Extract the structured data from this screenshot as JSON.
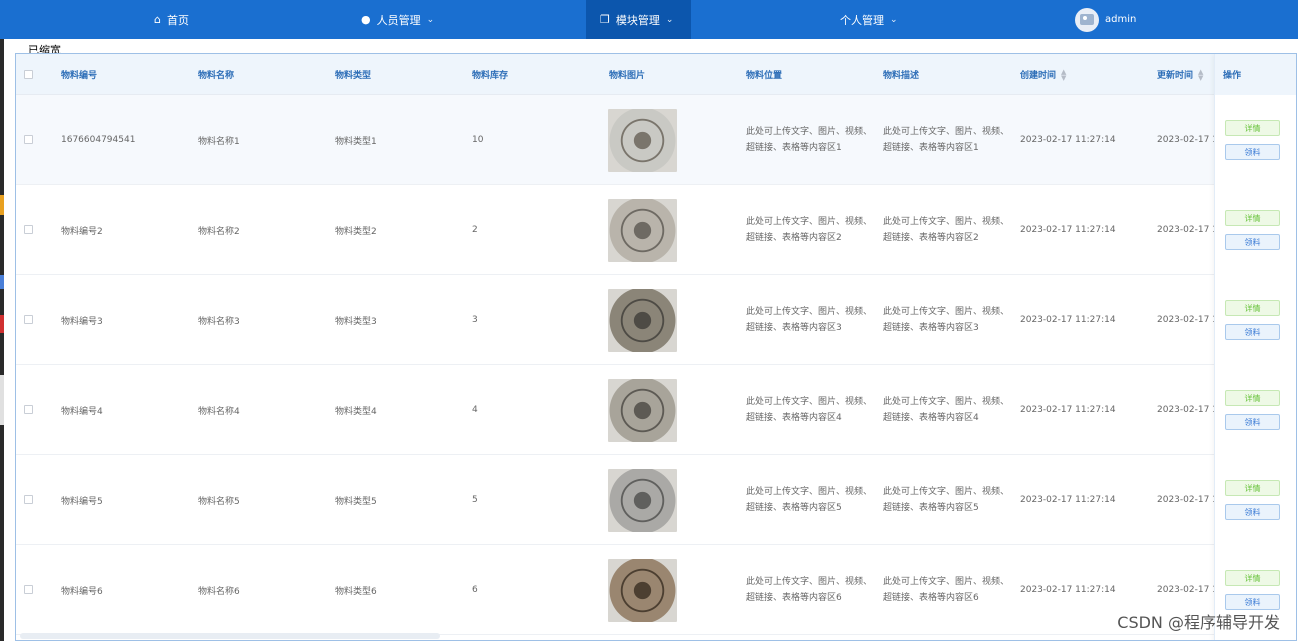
{
  "nav": {
    "items": [
      {
        "label": "首页",
        "icon": "home-icon"
      },
      {
        "label": "人员管理",
        "icon": "user-icon"
      },
      {
        "label": "模块管理",
        "icon": "module-icon"
      },
      {
        "label": "个人管理",
        "icon": ""
      }
    ],
    "username": "admin"
  },
  "overlay_label": "已缩宽",
  "table": {
    "headers": [
      "物料编号",
      "物料名称",
      "物料类型",
      "物料库存",
      "物料图片",
      "物料位置",
      "物料描述",
      "创建时间",
      "更新时间",
      "操作"
    ],
    "rows": [
      {
        "code": "1676604794541",
        "name": "物料名称1",
        "type": "物料类型1",
        "stock": "10",
        "location": "此处可上传文字、图片、视频、超链接、表格等内容区1",
        "desc": "此处可上传文字、图片、视频、超链接、表格等内容区1",
        "created": "2023-02-17 11:27:14",
        "updated": "2023-02-17 1"
      },
      {
        "code": "物料编号2",
        "name": "物料名称2",
        "type": "物料类型2",
        "stock": "2",
        "location": "此处可上传文字、图片、视频、超链接、表格等内容区2",
        "desc": "此处可上传文字、图片、视频、超链接、表格等内容区2",
        "created": "2023-02-17 11:27:14",
        "updated": "2023-02-17 1"
      },
      {
        "code": "物料编号3",
        "name": "物料名称3",
        "type": "物料类型3",
        "stock": "3",
        "location": "此处可上传文字、图片、视频、超链接、表格等内容区3",
        "desc": "此处可上传文字、图片、视频、超链接、表格等内容区3",
        "created": "2023-02-17 11:27:14",
        "updated": "2023-02-17 1"
      },
      {
        "code": "物料编号4",
        "name": "物料名称4",
        "type": "物料类型4",
        "stock": "4",
        "location": "此处可上传文字、图片、视频、超链接、表格等内容区4",
        "desc": "此处可上传文字、图片、视频、超链接、表格等内容区4",
        "created": "2023-02-17 11:27:14",
        "updated": "2023-02-17 1"
      },
      {
        "code": "物料编号5",
        "name": "物料名称5",
        "type": "物料类型5",
        "stock": "5",
        "location": "此处可上传文字、图片、视频、超链接、表格等内容区5",
        "desc": "此处可上传文字、图片、视频、超链接、表格等内容区5",
        "created": "2023-02-17 11:27:14",
        "updated": "2023-02-17 1"
      },
      {
        "code": "物料编号6",
        "name": "物料名称6",
        "type": "物料类型6",
        "stock": "6",
        "location": "此处可上传文字、图片、视频、超链接、表格等内容区6",
        "desc": "此处可上传文字、图片、视频、超链接、表格等内容区6",
        "created": "2023-02-17 11:27:14",
        "updated": "2023-02-17 1"
      }
    ],
    "actions": {
      "detail": "详情",
      "take": "领料"
    }
  },
  "watermark": "CSDN @程序辅导开发",
  "colors": {
    "nav_bg": "#1a6fd0",
    "nav_active": "#0c56ad",
    "header_text": "#2f6fb8"
  }
}
